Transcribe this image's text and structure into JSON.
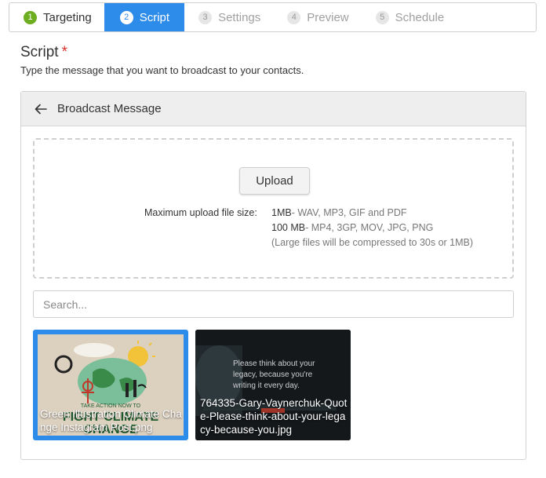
{
  "stepper": {
    "steps": [
      {
        "num": "1",
        "label": "Targeting",
        "state": "done"
      },
      {
        "num": "2",
        "label": "Script",
        "state": "active"
      },
      {
        "num": "3",
        "label": "Settings",
        "state": "todo"
      },
      {
        "num": "4",
        "label": "Preview",
        "state": "todo"
      },
      {
        "num": "5",
        "label": "Schedule",
        "state": "todo"
      }
    ]
  },
  "section": {
    "title": "Script",
    "required_mark": "*",
    "subtitle": "Type the message that you want to broadcast to your contacts."
  },
  "panel": {
    "title": "Broadcast Message",
    "back_icon": "arrow-left-icon",
    "upload_label": "Upload",
    "limits": {
      "label": "Maximum upload file size:",
      "small_size": "1MB",
      "small_types": " - WAV, MP3, GIF and PDF",
      "large_size": "100 MB",
      "large_types": " - MP4, 3GP, MOV, JPG, PNG",
      "note": "(Large files will be compressed to 30s or 1MB)"
    },
    "search_placeholder": "Search...",
    "media": [
      {
        "caption": "Green Illustration Climate Change Instagram Post.png",
        "selected": true
      },
      {
        "caption": "764335-Gary-Vaynerchuk-Quote-Please-think-about-your-legacy-because-you.jpg",
        "selected": false
      }
    ]
  },
  "colors": {
    "accent": "#2d8bea",
    "done": "#6cae1f",
    "required": "#d4342c"
  }
}
